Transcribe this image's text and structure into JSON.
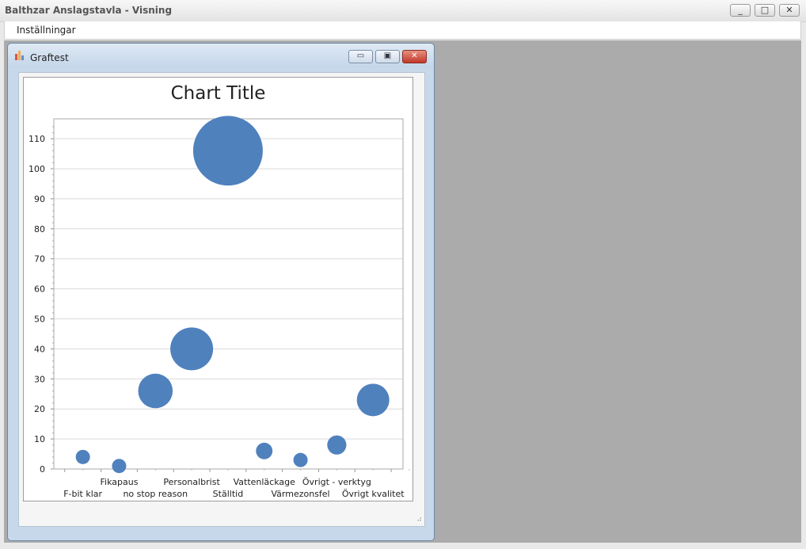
{
  "app": {
    "title": "Balthzar Anslagstavla - Visning",
    "window_buttons": {
      "minimize": "_",
      "maximize": "□",
      "close": "✕"
    }
  },
  "menu": {
    "items": [
      {
        "label": "Inställningar"
      }
    ]
  },
  "child_window": {
    "title": "Graftest",
    "buttons": {
      "minimize": "▭",
      "maximize": "▣",
      "close": "✕"
    }
  },
  "colors": {
    "bubble": "#4f81bd",
    "grid": "#d9d9d9",
    "mdi_background": "#ababab",
    "close_button": "#c1392b"
  },
  "chart_data": {
    "type": "scatter",
    "subtype": "bubble",
    "title": "Chart Title",
    "xlabel": "",
    "ylabel": "",
    "ylim": [
      0,
      115
    ],
    "yticks": [
      0,
      10,
      20,
      30,
      40,
      50,
      60,
      70,
      80,
      90,
      100,
      110
    ],
    "grid": true,
    "legend": "none",
    "categories": [
      "F-bit klar",
      "Fikapaus",
      "no stop reason",
      "Personalbrist",
      "Ställtid",
      "Vattenläckage",
      "Värmezonsfel",
      "Övrigt - verktyg",
      "Övrigt kvalitet"
    ],
    "values": [
      4,
      1,
      26,
      40,
      106,
      6,
      3,
      8,
      23
    ],
    "bubble_size": [
      4,
      1,
      26,
      40,
      106,
      6,
      3,
      8,
      23
    ]
  }
}
